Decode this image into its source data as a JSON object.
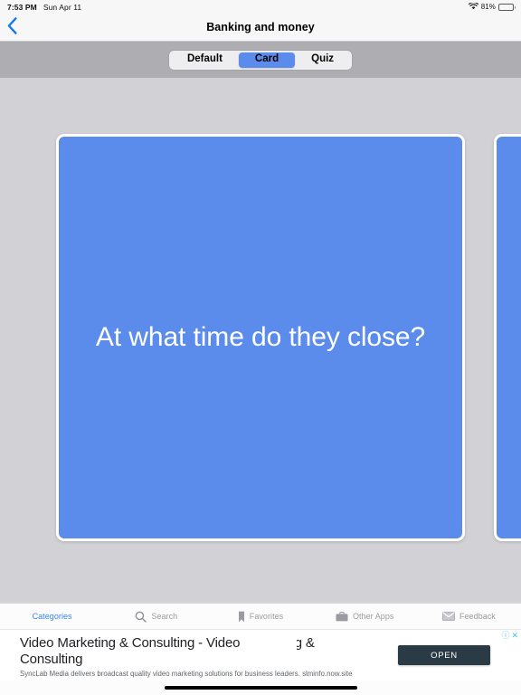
{
  "status_bar": {
    "time": "7:53 PM",
    "date": "Sun Apr 11",
    "wifi_icon": "wifi-icon",
    "battery_percent": "81%",
    "battery_icon": "battery-icon",
    "battery_level": 81
  },
  "nav_bar": {
    "back_icon": "chevron-left-icon",
    "title": "Banking and money"
  },
  "segmented_control": {
    "selected": "Card",
    "options": [
      {
        "label": "Default",
        "active": false
      },
      {
        "label": "Card",
        "active": true
      },
      {
        "label": "Quiz",
        "active": false
      }
    ]
  },
  "cards": [
    {
      "text": "At what time do they close?"
    },
    {
      "text": ""
    }
  ],
  "tab_bar": {
    "items": [
      {
        "label": "Categories",
        "icon": "",
        "active": true
      },
      {
        "label": "Search",
        "icon": "search-icon",
        "active": false
      },
      {
        "label": "Favorites",
        "icon": "bookmark-icon",
        "active": false
      },
      {
        "label": "Other Apps",
        "icon": "briefcase-icon",
        "active": false
      },
      {
        "label": "Feedback",
        "icon": "envelope-icon",
        "active": false
      }
    ]
  },
  "ad": {
    "title": "Video Marketing & Consulting - Video Marketing & Consulting",
    "description": "SyncLab Media delivers broadcast quality video marketing solutions for business leaders. slminfo.now.site",
    "cta_label": "OPEN",
    "info_badge": "ⓘ",
    "close_badge": "✕"
  },
  "colors": {
    "accent_blue": "#5b8ceb",
    "link_blue": "#3a84f2",
    "card_bg": "#5b8ceb",
    "page_bg": "#d1d1d6",
    "seg_band_bg": "#adadb2",
    "ad_cta_bg": "#2b3b45"
  }
}
